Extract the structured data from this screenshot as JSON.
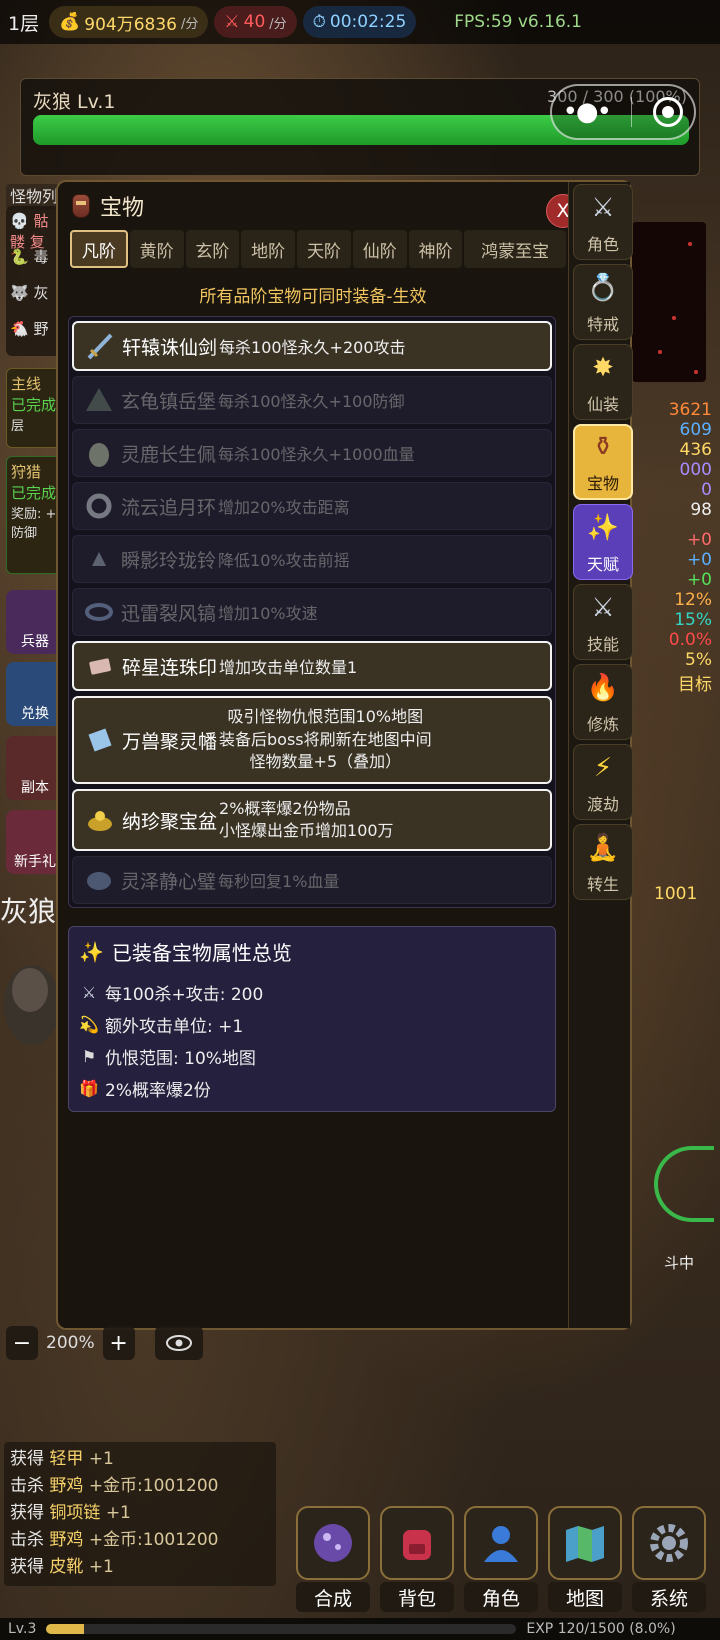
{
  "topbar": {
    "floor": "1层",
    "gold": "904万6836",
    "gold_unit": "/分",
    "attack": "40",
    "attack_unit": "/分",
    "timer": "00:02:25",
    "fps": "FPS:59 v6.16.1"
  },
  "monster": {
    "name": "灰狼 Lv.1",
    "hp_text": "300 / 300 (100%)",
    "hp_fraction": 1.0
  },
  "background": {
    "monster_tag": "怪物列",
    "quest1": [
      "主线",
      "已完成",
      "层"
    ],
    "quest2": [
      "狩猎",
      "已完成",
      "奖励: +",
      "防御"
    ],
    "buttons": [
      "兵器",
      "兑换",
      "副本",
      "新手礼"
    ],
    "left_list": [
      "骷髅 复",
      "毒",
      "灰",
      "野"
    ],
    "right_stats": [
      "3621",
      "609",
      "436",
      "000",
      "0",
      "98",
      "+0",
      "+0",
      "+0",
      "12%",
      "15%",
      "0.0%",
      "5%",
      "目标"
    ],
    "right_gold": "1001",
    "big_text": "灰狼",
    "fight": "斗中"
  },
  "modal": {
    "title": "宝物",
    "close_label": "X",
    "tabs": [
      "凡阶",
      "黄阶",
      "玄阶",
      "地阶",
      "天阶",
      "仙阶",
      "神阶",
      "鸿蒙至宝"
    ],
    "active_tab": 0,
    "subtitle": "所有品阶宝物可同时装备-生效",
    "items": [
      {
        "name": "轩辕诛仙剑",
        "desc": "每杀100怪永久+200攻击",
        "equipped": true,
        "icon": "sword-icon"
      },
      {
        "name": "玄龟镇岳堡",
        "desc": "每杀100怪永久+100防御",
        "equipped": false,
        "icon": "tortoise-fort-icon"
      },
      {
        "name": "灵鹿长生佩",
        "desc": "每杀100怪永久+1000血量",
        "equipped": false,
        "icon": "jade-pendant-icon"
      },
      {
        "name": "流云追月环",
        "desc": "增加20%攻击距离",
        "equipped": false,
        "icon": "ring-icon"
      },
      {
        "name": "瞬影玲珑铃",
        "desc": "降低10%攻击前摇",
        "equipped": false,
        "icon": "bell-icon"
      },
      {
        "name": "迅雷裂风镐",
        "desc": "增加10%攻速",
        "equipped": false,
        "icon": "bracelet-icon"
      },
      {
        "name": "碎星连珠印",
        "desc": "增加攻击单位数量1",
        "equipped": true,
        "icon": "seal-icon"
      },
      {
        "name": "万兽聚灵幡",
        "desc_lines": [
          "吸引怪物仇恨范围10%地图",
          "装备后boss将刷新在地图中间",
          "怪物数量+5（叠加）"
        ],
        "equipped": true,
        "icon": "banner-icon"
      },
      {
        "name": "纳珍聚宝盆",
        "desc_lines": [
          "2%概率爆2份物品",
          "小怪爆出金币增加100万"
        ],
        "equipped": true,
        "icon": "treasure-bowl-icon"
      },
      {
        "name": "灵泽静心璧",
        "desc": "每秒回复1%血量",
        "equipped": false,
        "icon": "jade-disc-icon"
      }
    ],
    "summary": {
      "title": "已装备宝物属性总览",
      "rows": [
        {
          "icon": "crossed-swords-icon",
          "text": "每100杀+攻击: 200"
        },
        {
          "icon": "swirl-icon",
          "text": "额外攻击单位: +1"
        },
        {
          "icon": "flag-icon",
          "text": "仇恨范围: 10%地图"
        },
        {
          "icon": "gift-icon",
          "text": "2%概率爆2份"
        }
      ]
    },
    "side_nav": [
      {
        "label": "角色",
        "icon": "crossed-swords-icon"
      },
      {
        "label": "特戒",
        "icon": "ring-icon"
      },
      {
        "label": "仙装",
        "icon": "sparkle-icon"
      },
      {
        "label": "宝物",
        "icon": "vase-icon",
        "active": true
      },
      {
        "label": "天赋",
        "icon": "stars-icon"
      },
      {
        "label": "技能",
        "icon": "crossed-swords-icon"
      },
      {
        "label": "修炼",
        "icon": "fire-icon"
      },
      {
        "label": "渡劫",
        "icon": "lightning-icon"
      },
      {
        "label": "转生",
        "icon": "meditation-icon"
      }
    ]
  },
  "zoom": {
    "minus": "−",
    "value": "200%",
    "plus": "+"
  },
  "log": [
    {
      "verb": "获得",
      "target": "轻甲",
      "amount": "+1"
    },
    {
      "verb": "击杀",
      "target": "野鸡",
      "amount": "+金币:1001200"
    },
    {
      "verb": "获得",
      "target": "铜项链",
      "amount": "+1"
    },
    {
      "verb": "击杀",
      "target": "野鸡",
      "amount": "+金币:1001200"
    },
    {
      "verb": "获得",
      "target": "皮靴",
      "amount": "+1"
    }
  ],
  "bottom_buttons": [
    "合成",
    "背包",
    "角色",
    "地图",
    "系统"
  ],
  "exp": {
    "level": "Lv.3",
    "text": "EXP 120/1500 (8.0%)",
    "fraction": 0.08
  }
}
